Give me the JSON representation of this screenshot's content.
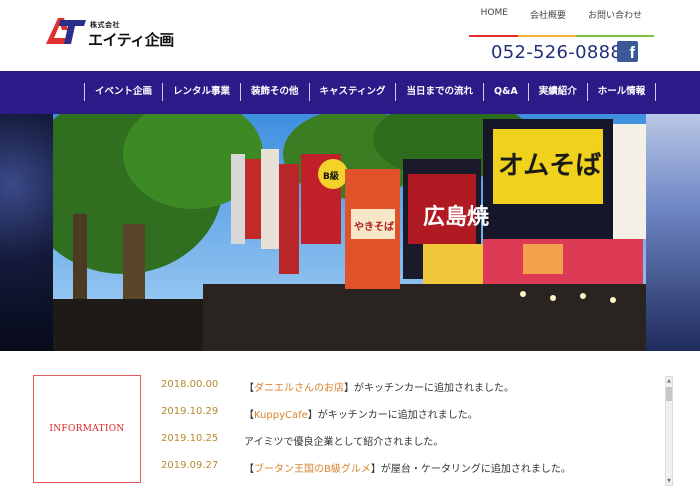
{
  "header": {
    "logo": {
      "small_text": "株式会社",
      "name": "エイティ企画",
      "mark": "AT"
    },
    "top_nav": [
      {
        "label": "HOME",
        "underline_color": "#e0312f"
      },
      {
        "label": "会社概要",
        "underline_color": "#f2b233"
      },
      {
        "label": "お問い合わせ",
        "underline_color": "#7cc242"
      }
    ],
    "phone": "052-526-0888",
    "facebook_icon": "facebook-icon",
    "facebook_glyph": "f"
  },
  "main_nav": [
    {
      "label": "イベント企画"
    },
    {
      "label": "レンタル事業"
    },
    {
      "label": "装飾その他"
    },
    {
      "label": "キャスティング"
    },
    {
      "label": "当日までの流れ"
    },
    {
      "label": "Q&A"
    },
    {
      "label": "実績紹介"
    },
    {
      "label": "ホール情報"
    }
  ],
  "hero": {
    "signs": [
      {
        "text": "広島焼"
      },
      {
        "text": "オムそば"
      },
      {
        "text": "やきそば"
      },
      {
        "text": "B級"
      }
    ]
  },
  "information": {
    "title": "INFORMATION",
    "items": [
      {
        "date": "2018.00.00",
        "pre": "【",
        "link": "ダニエルさんのお店",
        "post": "】がキッチンカーに追加されました。"
      },
      {
        "date": "2019.10.29",
        "pre": "【",
        "link": "KuppyCafe",
        "post": "】がキッチンカーに追加されました。"
      },
      {
        "date": "2019.10.25",
        "pre": "",
        "link": "",
        "post": "アイミツで優良企業として紹介されました。"
      },
      {
        "date": "2019.09.27",
        "pre": "【",
        "link": "ブータン王国のB級グルメ",
        "post": "】が屋台・ケータリングに追加されました。"
      }
    ]
  },
  "scrollbar": {
    "up_glyph": "▲",
    "down_glyph": "▼"
  },
  "colors": {
    "nav_background": "#2b1a87",
    "phone": "#23307a",
    "info_border": "#e35a5a",
    "date": "#b58a2e",
    "link": "#d9822b",
    "logo_red": "#e0312f",
    "logo_blue": "#2b2f8a"
  }
}
